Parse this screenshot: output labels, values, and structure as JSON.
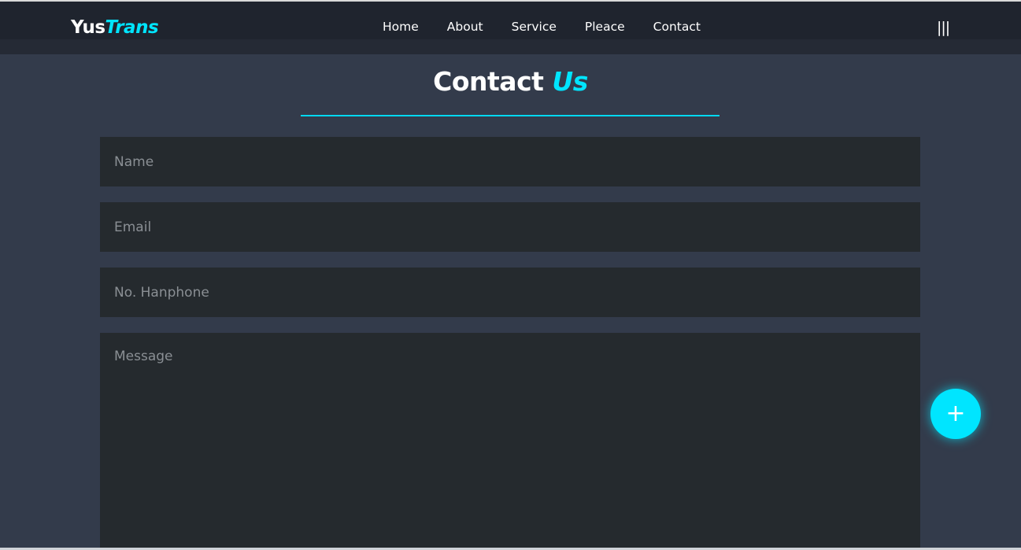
{
  "brand": {
    "main": "Yus",
    "accent": "Trans"
  },
  "nav": {
    "items": [
      {
        "label": "Home"
      },
      {
        "label": "About"
      },
      {
        "label": "Service"
      },
      {
        "label": "Pleace"
      },
      {
        "label": "Contact"
      }
    ],
    "menu_icon_glyph": "|||"
  },
  "contact": {
    "title_main": "Contact",
    "title_accent": "Us",
    "name_placeholder": "Name",
    "email_placeholder": "Email",
    "phone_placeholder": "No. Hanphone",
    "message_placeholder": "Message"
  },
  "fab": {
    "glyph": "+"
  },
  "colors": {
    "accent": "#00e5ff",
    "background": "#333b4b",
    "navbar": "#252a35",
    "field": "#252a2e"
  },
  "icons": {
    "menu": "hamburger-menu-icon",
    "fab": "plus-icon"
  }
}
